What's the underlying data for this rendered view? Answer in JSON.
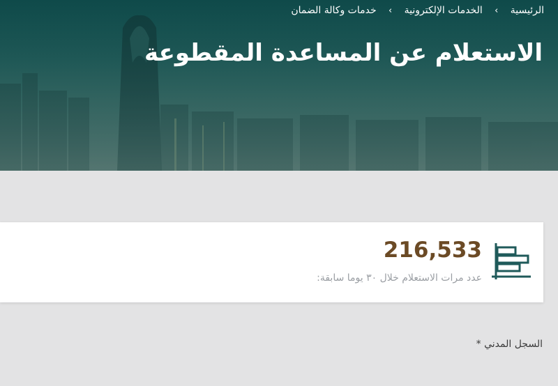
{
  "breadcrumb": {
    "items": [
      {
        "label": "الرئيسية"
      },
      {
        "label": "الخدمات الإلكترونية"
      },
      {
        "label": "خدمات وكالة الضمان"
      }
    ],
    "separator": "›"
  },
  "page_title": "الاستعلام عن المساعدة المقطوعة",
  "stat": {
    "value": "216,533",
    "label": "عدد مرات الاستعلام خلال ٣٠ يوما سابقة:",
    "icon": "bar-chart-icon"
  },
  "form": {
    "field_label": "السجل المدني",
    "required_mark": "*"
  },
  "colors": {
    "hero_teal": "#1d5856",
    "stat_value": "#6b4a25",
    "icon_teal": "#1f5a5a",
    "page_bg": "#e3e3e4"
  }
}
